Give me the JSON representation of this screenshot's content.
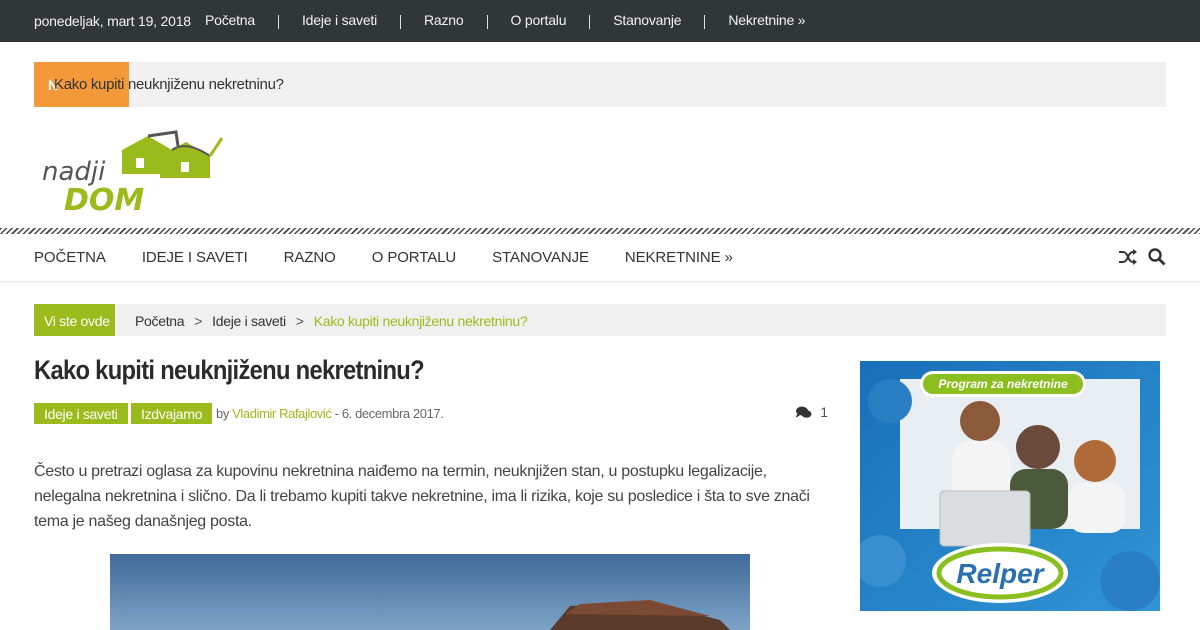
{
  "topbar": {
    "date": "ponedeljak, mart 19, 2018",
    "links": [
      "Početna",
      "Ideje i saveti",
      "Razno",
      "O portalu",
      "Stanovanje",
      "Nekretnine »"
    ]
  },
  "ticker": {
    "label": "N",
    "text": "Kako kupiti neuknjiženu nekretninu?"
  },
  "logo": {
    "line1": "nadji",
    "line2": "DOM"
  },
  "mainnav": {
    "items": [
      "POČETNA",
      "IDEJE I SAVETI",
      "RAZNO",
      "O PORTALU",
      "STANOVANJE",
      "NEKRETNINE »"
    ],
    "icons": [
      "shuffle-icon",
      "search-icon"
    ]
  },
  "breadcrumb": {
    "label": "Vi ste ovde",
    "home": "Početna",
    "section": "Ideje i saveti",
    "current": "Kako kupiti neuknjiženu nekretninu?",
    "separator": ">"
  },
  "article": {
    "title": "Kako kupiti neuknjiženu nekretninu?",
    "categories": [
      "Ideje i saveti",
      "Izdvajamo"
    ],
    "by": "by",
    "author": "Vladimir Rafajlović",
    "date": " - 6. decembra 2017.",
    "comments": "1",
    "intro": "Često u pretrazi oglasa za kupovinu nekretnina naiđemo na termin, neuknjižen stan, u postupku legalizacije, nelegalna nekretnina i slično. Da li trebamo kupiti takve nekretnine, ima li rizika, koje su posledice i šta to sve znači tema je našeg današnjeg posta."
  },
  "ad": {
    "tagline": "Program za nekretnine",
    "brand": "Relper"
  },
  "colors": {
    "accent": "#9bbb1c",
    "ticker_label": "#f3993a",
    "topbar_bg": "#313738"
  }
}
